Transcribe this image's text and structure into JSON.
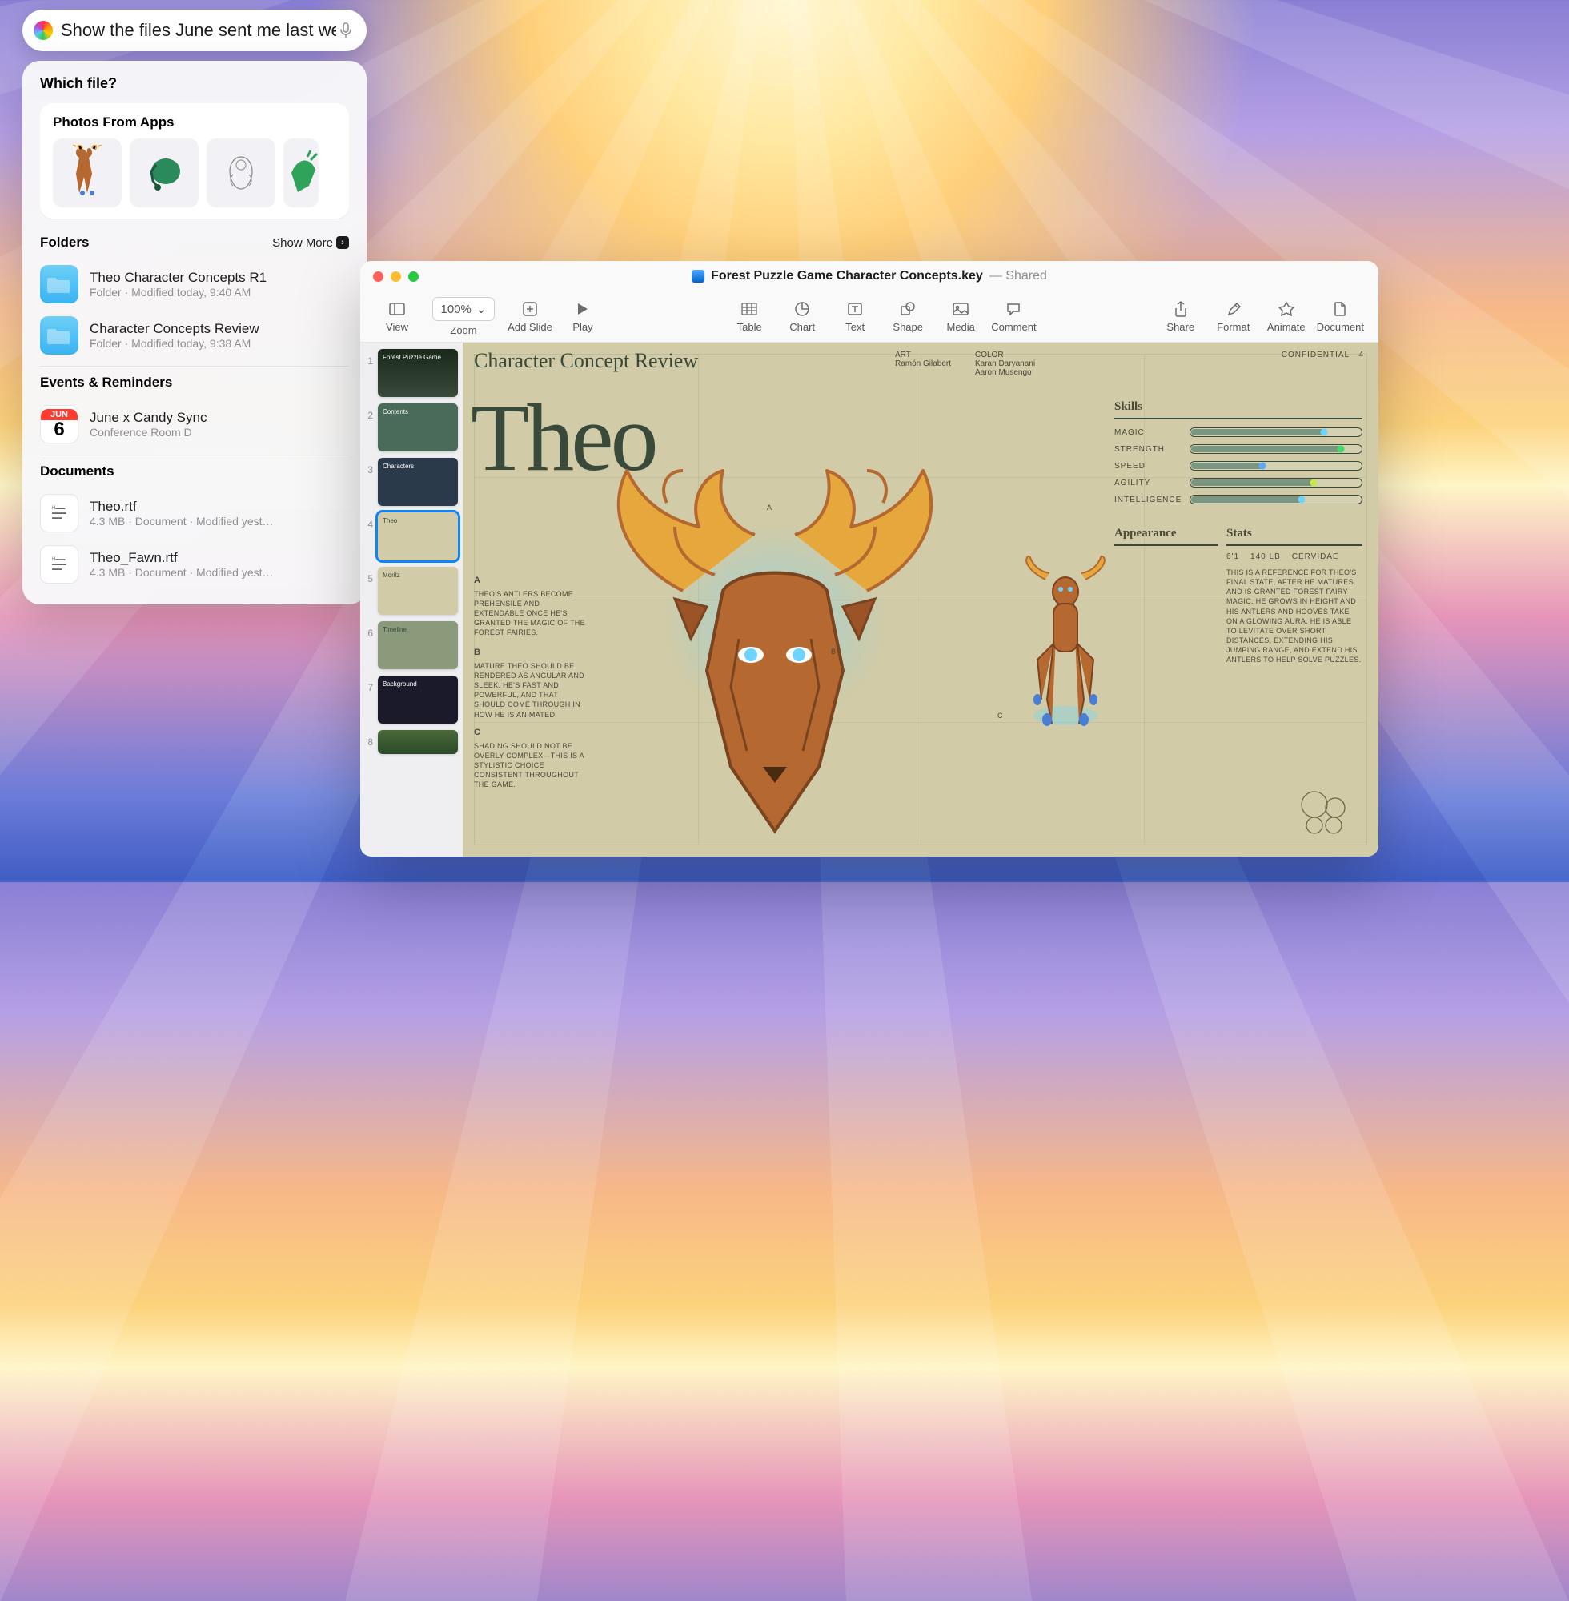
{
  "spotlight": {
    "query": "Show the files June sent me last week",
    "prompt": "Which file?",
    "photos_header": "Photos From Apps",
    "folders_header": "Folders",
    "show_more": "Show More",
    "events_header": "Events & Reminders",
    "documents_header": "Documents",
    "folders": [
      {
        "title": "Theo Character Concepts R1",
        "sub": "Folder · Modified today, 9:40 AM"
      },
      {
        "title": "Character Concepts Review",
        "sub": "Folder · Modified today, 9:38 AM"
      }
    ],
    "events": [
      {
        "month": "JUN",
        "day": "6",
        "title": "June x Candy Sync",
        "sub": "Conference Room D"
      }
    ],
    "documents": [
      {
        "title": "Theo.rtf",
        "sub": "4.3 MB · Document · Modified yest…"
      },
      {
        "title": "Theo_Fawn.rtf",
        "sub": "4.3 MB · Document · Modified yest…"
      }
    ]
  },
  "keynote": {
    "filename": "Forest Puzzle Game Character Concepts.key",
    "shared": "Shared",
    "zoom": "100%",
    "toolbar": [
      {
        "icon": "sidebar",
        "label": "View"
      },
      {
        "icon": "zoom",
        "label": "Zoom"
      },
      {
        "icon": "plus",
        "label": "Add Slide"
      },
      {
        "icon": "play",
        "label": "Play"
      },
      {
        "icon": "table",
        "label": "Table"
      },
      {
        "icon": "chart",
        "label": "Chart"
      },
      {
        "icon": "text",
        "label": "Text"
      },
      {
        "icon": "shape",
        "label": "Shape"
      },
      {
        "icon": "media",
        "label": "Media"
      },
      {
        "icon": "comment",
        "label": "Comment"
      },
      {
        "icon": "share",
        "label": "Share"
      },
      {
        "icon": "format",
        "label": "Format"
      },
      {
        "icon": "animate",
        "label": "Animate"
      },
      {
        "icon": "document",
        "label": "Document"
      }
    ],
    "slides": [
      {
        "n": "1",
        "title": "Forest Puzzle Game"
      },
      {
        "n": "2",
        "title": "Contents"
      },
      {
        "n": "3",
        "title": "Characters"
      },
      {
        "n": "4",
        "title": "Theo"
      },
      {
        "n": "5",
        "title": "Moritz"
      },
      {
        "n": "6",
        "title": "Timeline"
      },
      {
        "n": "7",
        "title": "Background"
      },
      {
        "n": "8",
        "title": ""
      }
    ],
    "canvas": {
      "section_title": "Character Concept Review",
      "char_name": "Theo",
      "confidential": "CONFIDENTIAL",
      "page_num": "4",
      "art_label": "ART",
      "art_name": "Ramón Gilabert",
      "color_label": "COLOR",
      "color_name1": "Karan Daryanani",
      "color_name2": "Aaron Musengo",
      "skills_header": "Skills",
      "skills": [
        {
          "name": "MAGIC",
          "pct": 78,
          "dot": "#6fd3ff"
        },
        {
          "name": "STRENGTH",
          "pct": 88,
          "dot": "#43d86b"
        },
        {
          "name": "SPEED",
          "pct": 42,
          "dot": "#5aa9ff"
        },
        {
          "name": "AGILITY",
          "pct": 72,
          "dot": "#c5e84a"
        },
        {
          "name": "INTELLIGENCE",
          "pct": 65,
          "dot": "#6fd3ff"
        }
      ],
      "appearance_header": "Appearance",
      "stats_header": "Stats",
      "stats": {
        "height": "6'1",
        "weight": "140 LB",
        "species": "CERVIDAE"
      },
      "stats_body": "THIS IS A REFERENCE FOR THEO'S FINAL STATE, AFTER HE MATURES AND IS GRANTED FOREST FAIRY MAGIC. HE GROWS IN HEIGHT AND HIS ANTLERS AND HOOVES TAKE ON A GLOWING AURA. HE IS ABLE TO LEVITATE OVER SHORT DISTANCES, EXTENDING HIS JUMPING RANGE, AND EXTEND HIS ANTLERS TO HELP SOLVE PUZZLES.",
      "noteA": {
        "h": "A",
        "t": "THEO'S ANTLERS BECOME PREHENSILE AND EXTENDABLE ONCE HE'S GRANTED THE MAGIC OF THE FOREST FAIRIES."
      },
      "noteB": {
        "h": "B",
        "t": "MATURE THEO SHOULD BE RENDERED AS ANGULAR AND SLEEK. HE'S FAST AND POWERFUL, AND THAT SHOULD COME THROUGH IN HOW HE IS ANIMATED."
      },
      "noteC": {
        "h": "C",
        "t": "SHADING SHOULD NOT BE OVERLY COMPLEX—THIS IS A STYLISTIC CHOICE CONSISTENT THROUGHOUT THE GAME."
      },
      "labelA": "A",
      "labelB": "B",
      "labelC": "C"
    }
  }
}
